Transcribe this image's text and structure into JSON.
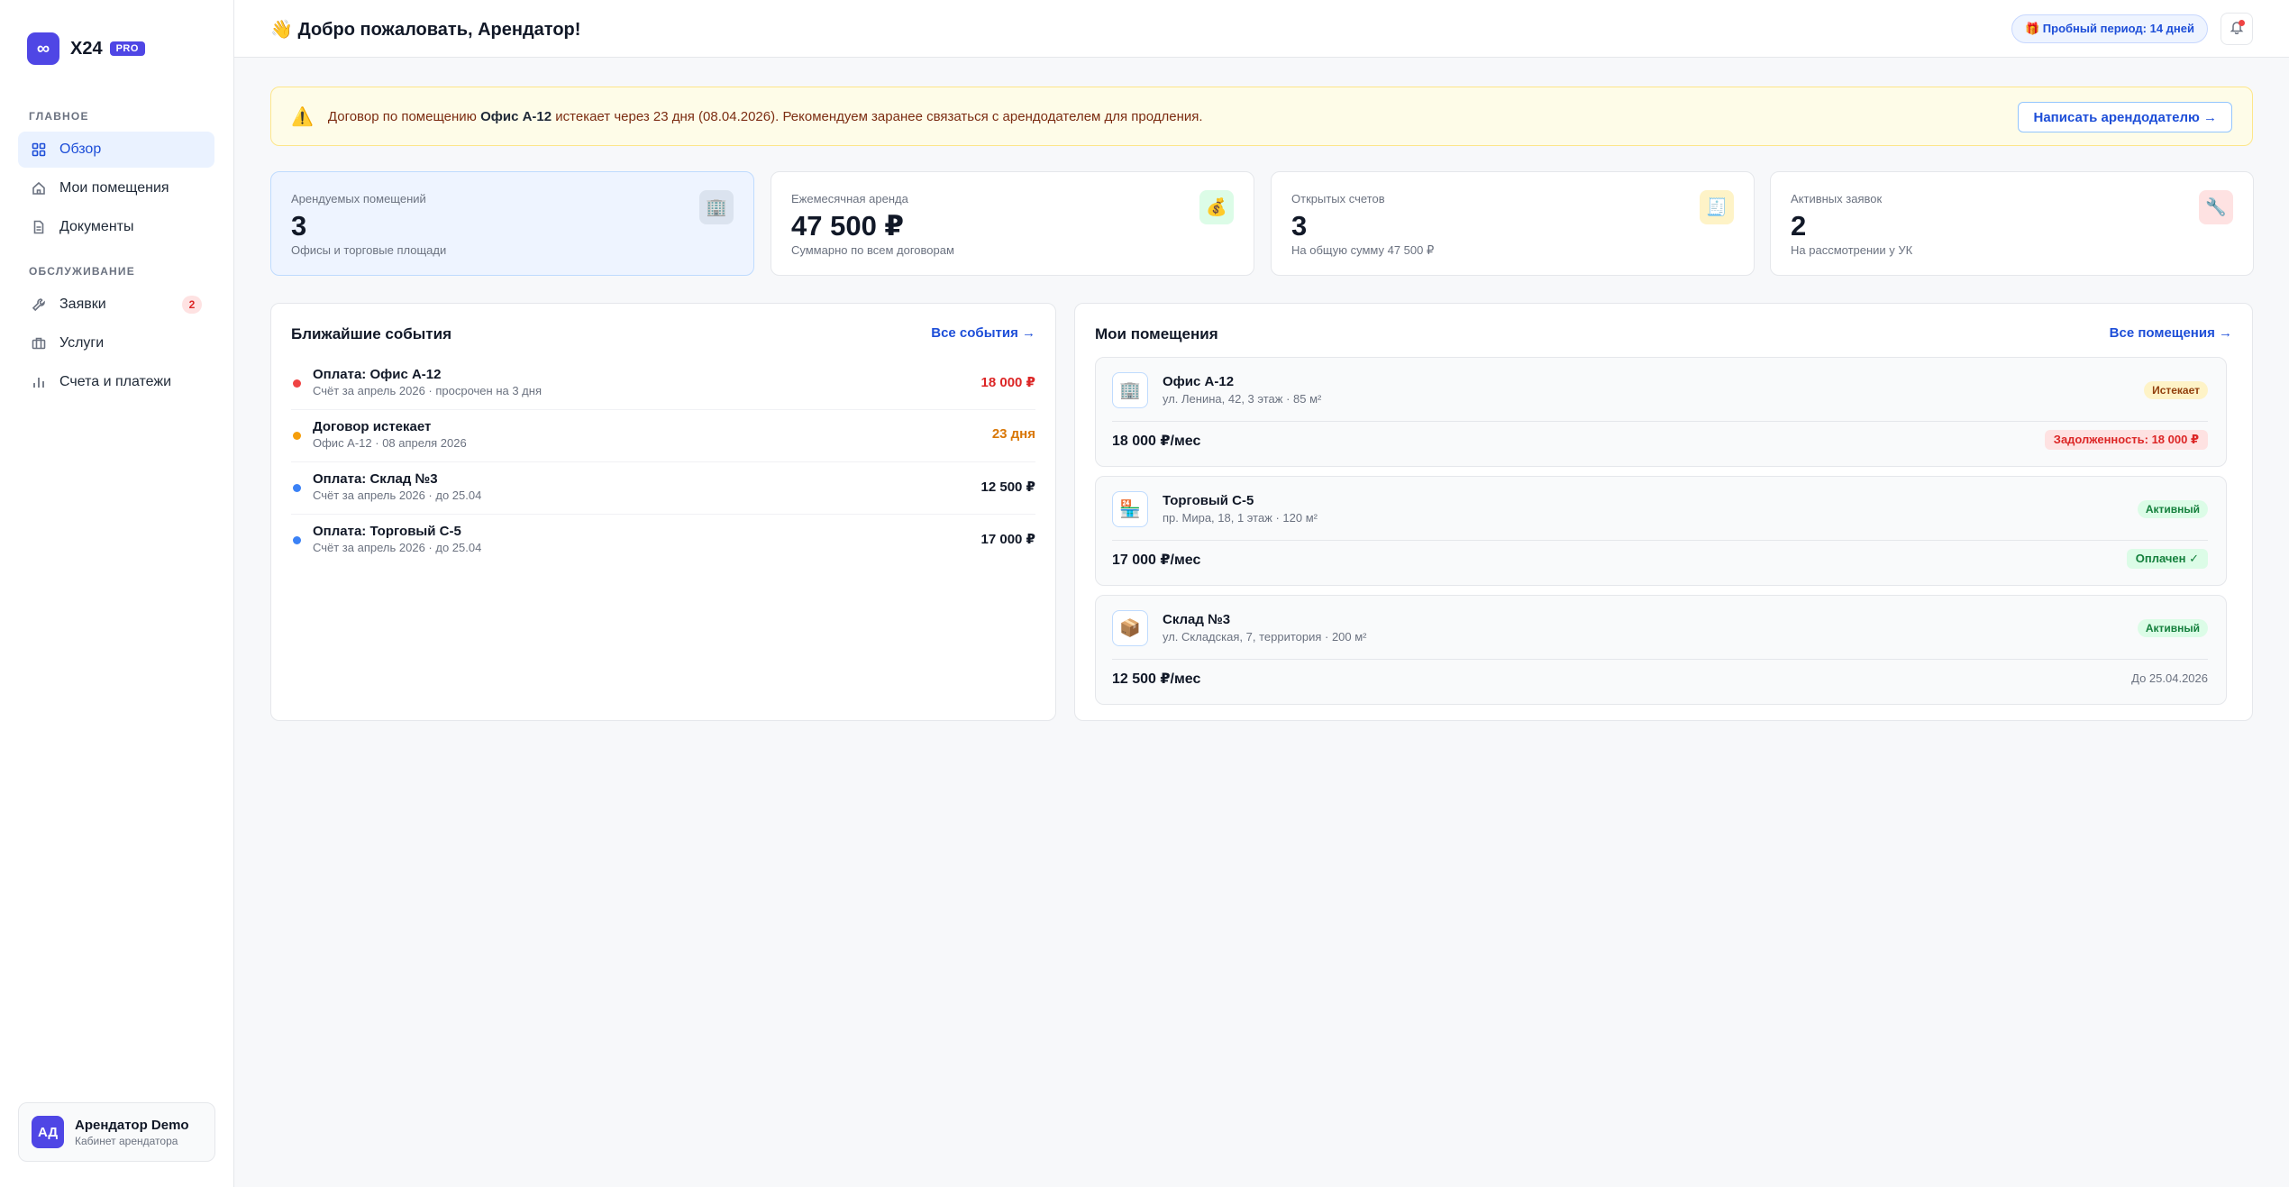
{
  "brand": {
    "logo": "∞",
    "name": "X24",
    "badge": "PRO"
  },
  "sidebar": {
    "section_main": "ГЛАВНОЕ",
    "section_service": "ОБСЛУЖИВАНИЕ",
    "items": [
      {
        "label": "Обзор",
        "icon": "grid-icon"
      },
      {
        "label": "Мои помещения",
        "icon": "home-icon"
      },
      {
        "label": "Документы",
        "icon": "document-icon"
      },
      {
        "label": "Заявки",
        "icon": "wrench-icon",
        "count": "2"
      },
      {
        "label": "Услуги",
        "icon": "briefcase-icon"
      },
      {
        "label": "Счета и платежи",
        "icon": "bar-chart-icon"
      }
    ]
  },
  "user": {
    "initials": "АД",
    "name": "Арендатор Demo",
    "role": "Кабинет арендатора"
  },
  "header": {
    "welcome": "👋 Добро пожаловать, Арендатор!",
    "trial": "🎁 Пробный период: 14 дней"
  },
  "alert": {
    "icon": "⚠️",
    "text_before": "Договор по помещению ",
    "text_bold": "Офис А-12",
    "text_after": " истекает через 23 дня (08.04.2026). Рекомендуем заранее связаться с арендодателем для продления.",
    "button": "Написать арендодателю →"
  },
  "stats": [
    {
      "label": "Арендуемых помещений",
      "value": "3",
      "sub": "Офисы и торговые площади",
      "icon": "🏢",
      "icon_bg": "#dbe3ef"
    },
    {
      "label": "Ежемесячная аренда",
      "value": "47 500 ₽",
      "sub": "Суммарно по всем договорам",
      "icon": "💰",
      "icon_bg": "#dcfce7"
    },
    {
      "label": "Открытых счетов",
      "value": "3",
      "sub": "На общую сумму 47 500 ₽",
      "icon": "🧾",
      "icon_bg": "#fef3c7"
    },
    {
      "label": "Активных заявок",
      "value": "2",
      "sub": "На рассмотрении у УК",
      "icon": "🔧",
      "icon_bg": "#fee2e2"
    }
  ],
  "events": {
    "title": "Ближайшие события",
    "link": "Все события →",
    "items": [
      {
        "title": "Оплата: Офис А-12",
        "sub": "Счёт за апрель 2026 · просрочен на 3 дня",
        "amount": "18 000 ₽",
        "dot": "#ef4444",
        "amount_color": "#dc2626"
      },
      {
        "title": "Договор истекает",
        "sub": "Офис А-12 · 08 апреля 2026",
        "amount": "23 дня",
        "dot": "#f59e0b",
        "amount_color": "#d97706"
      },
      {
        "title": "Оплата: Склад №3",
        "sub": "Счёт за апрель 2026 · до 25.04",
        "amount": "12 500 ₽",
        "dot": "#3b82f6",
        "amount_color": "#111827"
      },
      {
        "title": "Оплата: Торговый С-5",
        "sub": "Счёт за апрель 2026 · до 25.04",
        "amount": "17 000 ₽",
        "dot": "#3b82f6",
        "amount_color": "#111827"
      }
    ]
  },
  "properties": {
    "title": "Мои помещения",
    "link": "Все помещения →",
    "items": [
      {
        "icon": "🏢",
        "name": "Офис А-12",
        "addr": "ул. Ленина, 42, 3 этаж · 85 м²",
        "status": "Истекает",
        "status_bg": "#fef3c7",
        "status_color": "#92400e",
        "rent": "18 000 ₽/мес",
        "meta": "Задолженность: 18 000 ₽",
        "meta_bg": "#fee2e2",
        "meta_color": "#dc2626"
      },
      {
        "icon": "🏪",
        "name": "Торговый С-5",
        "addr": "пр. Мира, 18, 1 этаж · 120 м²",
        "status": "Активный",
        "status_bg": "#dcfce7",
        "status_color": "#15803d",
        "rent": "17 000 ₽/мес",
        "meta": "Оплачен ✓",
        "meta_bg": "#dcfce7",
        "meta_color": "#15803d"
      },
      {
        "icon": "📦",
        "name": "Склад №3",
        "addr": "ул. Складская, 7, территория · 200 м²",
        "status": "Активный",
        "status_bg": "#dcfce7",
        "status_color": "#15803d",
        "rent": "12 500 ₽/мес",
        "meta": "До 25.04.2026",
        "meta_bg": "",
        "meta_color": "#6b7280"
      }
    ]
  },
  "colors": {
    "accent": "#4f46e5",
    "link": "#1d4ed8",
    "danger": "#dc2626",
    "warning": "#d97706",
    "success": "#15803d"
  }
}
